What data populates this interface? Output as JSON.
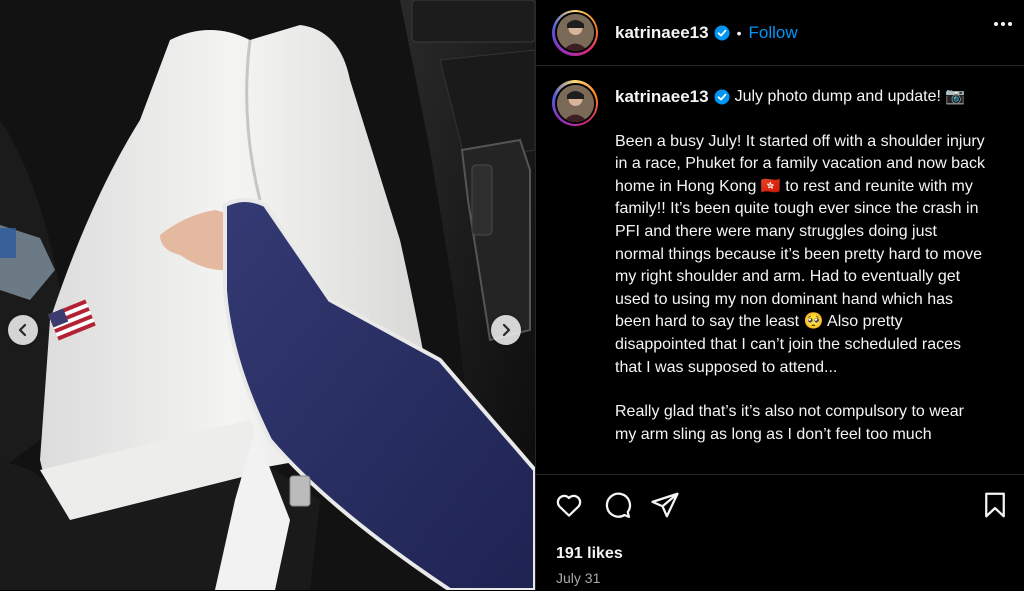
{
  "post": {
    "username": "katrinaee13",
    "follow_label": "Follow",
    "separator": "•",
    "verified_icon": "verified-badge-icon",
    "caption_headline": "July photo dump and update! 📷",
    "caption_paragraph_1": "Been a busy July! It started off with a shoulder injury in a race, Phuket for a family vacation and now back home in Hong Kong 🇭🇰 to rest and reunite with my family!! It’s been quite tough ever since the crash in PFI and there were many struggles doing just normal things because it’s been pretty hard to move my right shoulder and arm. Had to eventually get used to using my non dominant hand which has been hard to say the least 🥺 Also pretty disappointed that I can’t join the scheduled races that I was supposed to attend...",
    "caption_paragraph_2": "Really glad that’s it’s also not compulsory to wear my arm sling as long as I don’t feel too much",
    "likes": "191 likes",
    "date": "July 31"
  },
  "colors": {
    "accent": "#0095f6",
    "background": "#000000",
    "text": "#f5f5f5",
    "muted": "#a8a8a8",
    "divider": "#262626"
  },
  "icons": [
    "heart-icon",
    "comment-icon",
    "share-icon",
    "bookmark-icon",
    "more-options-icon",
    "chevron-left-icon",
    "chevron-right-icon"
  ]
}
